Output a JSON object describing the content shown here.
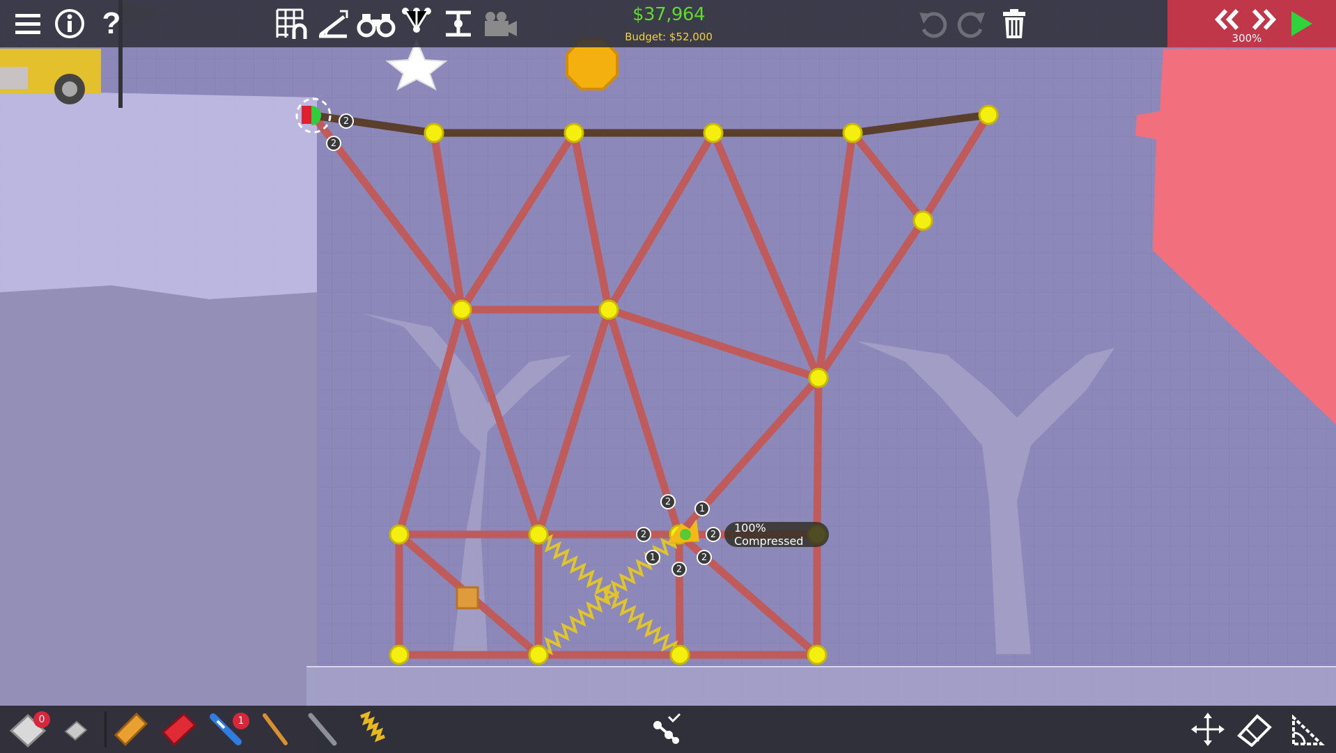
{
  "colors": {
    "road": "#5a3f2c",
    "wood": "#c05b5b",
    "joint": "#f5ef10",
    "spring": "#e0c42e",
    "money": "#5bdc2c",
    "budget": "#f2d433",
    "target_zone": "#f2707e"
  },
  "hud": {
    "cost": "$37,964",
    "budget": "Budget: $52,000",
    "speed": "300%",
    "menu_icon": "hamburger-icon",
    "info_icon": "info-icon",
    "help_icon": "question-icon",
    "toolbar_icons": [
      "grid-anchor-icon",
      "ramp-icon",
      "binoculars-icon",
      "joint-select-icon",
      "resize-icon",
      "camera-icon"
    ],
    "right_icons": [
      "undo-icon",
      "redo-icon",
      "trash-icon",
      "rewind-icon",
      "fast-forward-icon",
      "play-icon"
    ]
  },
  "materials": {
    "items": [
      {
        "icon": "eraser-stack-icon",
        "count": "0"
      },
      {
        "icon": "small-eraser-icon"
      },
      {
        "icon": "road-plank-icon"
      },
      {
        "icon": "reinforced-road-icon"
      },
      {
        "icon": "hydraulic-piston-icon",
        "count": "1"
      },
      {
        "icon": "wood-beam-icon"
      },
      {
        "icon": "steel-cable-icon"
      },
      {
        "icon": "spring-icon"
      }
    ],
    "center_icon": "split-joints-icon",
    "right_icons": [
      "move-icon",
      "eraser-icon",
      "triangle-edit-icon"
    ]
  },
  "tooltip": "100% Compressed",
  "joint_badges": [
    "2",
    "2",
    "2",
    "1",
    "2",
    "2",
    "1",
    "2",
    "2"
  ]
}
